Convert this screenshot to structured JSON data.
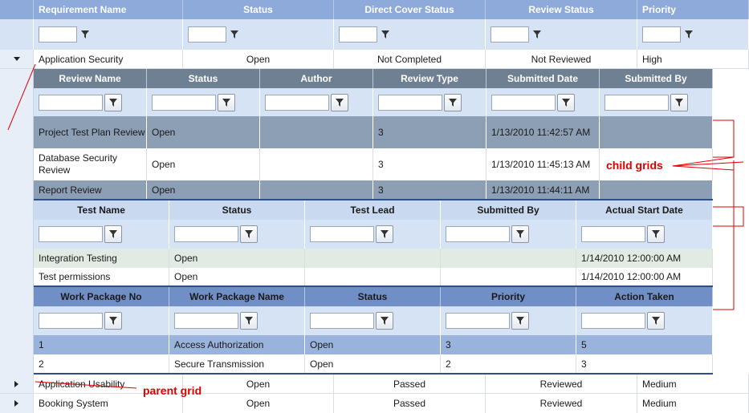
{
  "parent_grid": {
    "columns": [
      "Requirement Name",
      "Status",
      "Direct Cover Status",
      "Review Status",
      "Priority"
    ],
    "rows": [
      {
        "name": "Application Security",
        "status": "Open",
        "direct_cover": "Not Completed",
        "review_status": "Not Reviewed",
        "priority": "High"
      },
      {
        "name": "Application Usability",
        "status": "Open",
        "direct_cover": "Passed",
        "review_status": "Reviewed",
        "priority": "Medium"
      },
      {
        "name": "Booking System",
        "status": "Open",
        "direct_cover": "Passed",
        "review_status": "Reviewed",
        "priority": "Medium"
      }
    ]
  },
  "review_grid": {
    "columns": [
      "Review Name",
      "Status",
      "Author",
      "Review Type",
      "Submitted Date",
      "Submitted By"
    ],
    "rows": [
      {
        "name": "Project Test Plan Review",
        "status": "Open",
        "author": "",
        "type": "3",
        "date": "1/13/2010 11:42:57 AM",
        "by": ""
      },
      {
        "name": "Database Security Review",
        "status": "Open",
        "author": "",
        "type": "3",
        "date": "1/13/2010 11:45:13 AM",
        "by": ""
      },
      {
        "name": "Report Review",
        "status": "Open",
        "author": "",
        "type": "3",
        "date": "1/13/2010 11:44:11 AM",
        "by": ""
      }
    ]
  },
  "test_grid": {
    "columns": [
      "Test Name",
      "Status",
      "Test Lead",
      "Submitted By",
      "Actual Start Date"
    ],
    "rows": [
      {
        "name": "Integration Testing",
        "status": "Open",
        "lead": "",
        "by": "",
        "start": "1/14/2010 12:00:00 AM"
      },
      {
        "name": "Test permissions",
        "status": "Open",
        "lead": "",
        "by": "",
        "start": "1/14/2010 12:00:00 AM"
      }
    ]
  },
  "workpackage_grid": {
    "columns": [
      "Work Package No",
      "Work Package Name",
      "Status",
      "Priority",
      "Action Taken"
    ],
    "rows": [
      {
        "no": "1",
        "name": "Access Authorization",
        "status": "Open",
        "priority": "3",
        "action": "5"
      },
      {
        "no": "2",
        "name": "Secure Transmission",
        "status": "Open",
        "priority": "2",
        "action": "3"
      }
    ]
  },
  "annotations": {
    "child_grids": "child grids",
    "parent_grid": "parent grid"
  },
  "colors": {
    "parent_header": "#8eaadb",
    "child_header_dark": "#6f8093",
    "child_header_light": "#c8d9f0",
    "wp_header": "#6f8fc6",
    "annotation_red": "#e00000"
  },
  "icons": {
    "filter": "funnel-icon",
    "expand": "triangle-expander-icon"
  }
}
